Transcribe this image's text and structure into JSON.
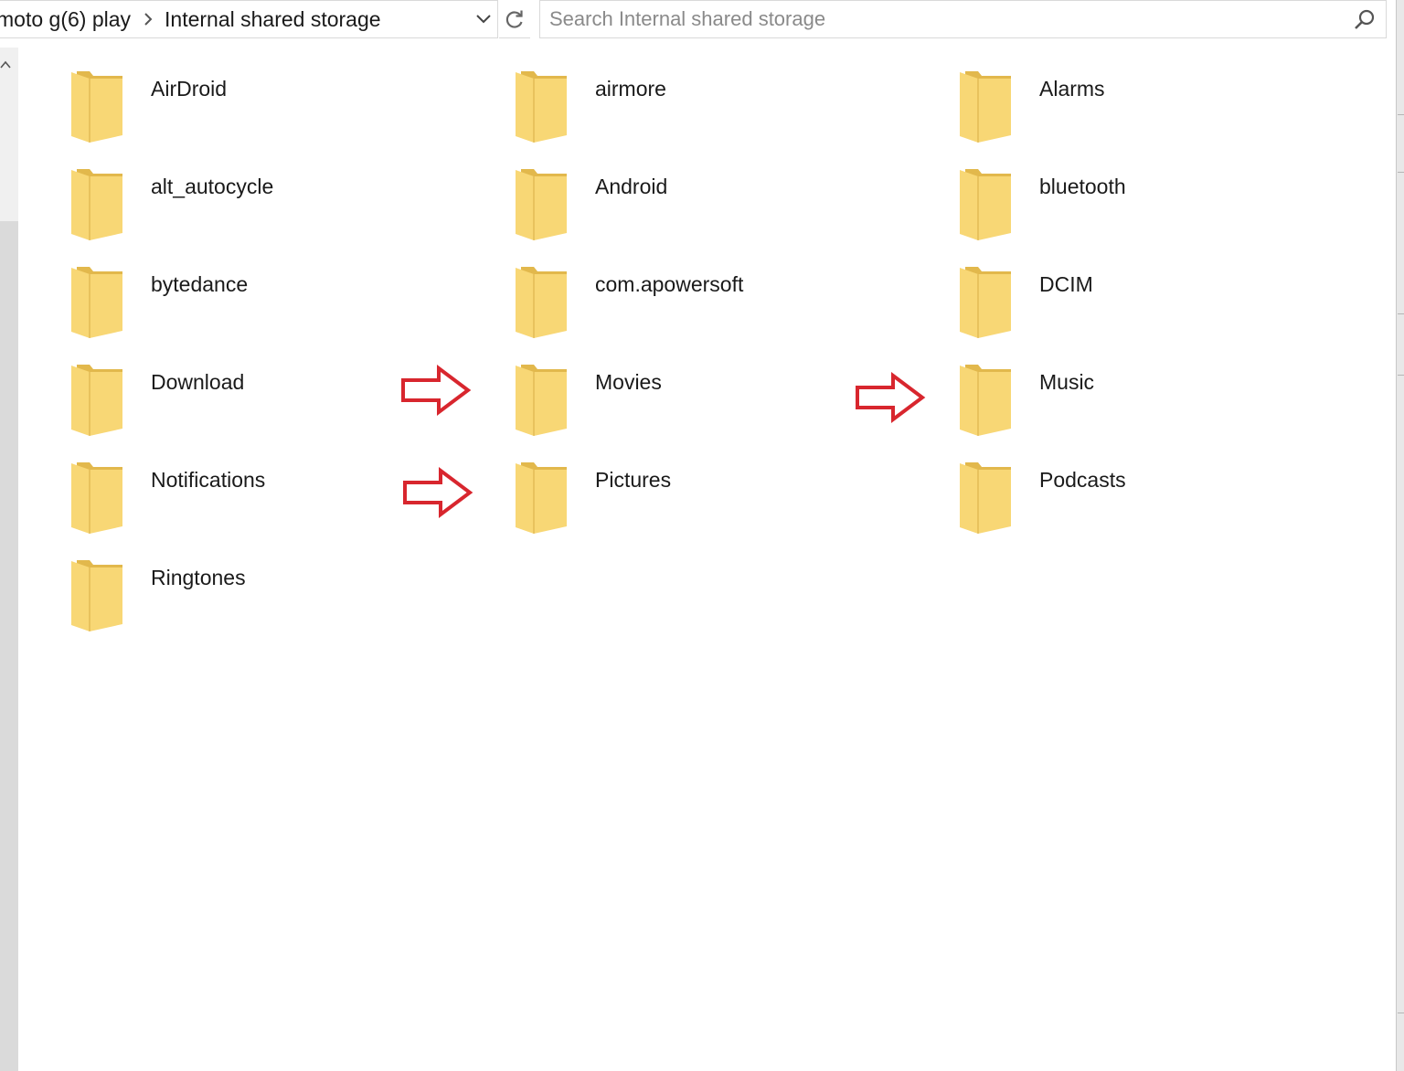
{
  "address_bar": {
    "crumbs": [
      "moto g(6) play",
      "Internal shared storage"
    ]
  },
  "search": {
    "placeholder": "Search Internal shared storage",
    "value": ""
  },
  "folders": [
    {
      "name": "AirDroid"
    },
    {
      "name": "airmore"
    },
    {
      "name": "Alarms"
    },
    {
      "name": "alt_autocycle"
    },
    {
      "name": "Android"
    },
    {
      "name": "bluetooth"
    },
    {
      "name": "bytedance"
    },
    {
      "name": "com.apowersoft"
    },
    {
      "name": "DCIM"
    },
    {
      "name": "Download"
    },
    {
      "name": "Movies"
    },
    {
      "name": "Music"
    },
    {
      "name": "Notifications"
    },
    {
      "name": "Pictures"
    },
    {
      "name": "Podcasts"
    },
    {
      "name": "Ringtones"
    }
  ],
  "annotations": {
    "arrows_point_to": [
      "Movies",
      "Music",
      "Pictures"
    ],
    "arrow_color": "#d8262e"
  },
  "colors": {
    "folder_front": "#f8d775",
    "folder_back": "#e2b84c",
    "border": "#d9d9d9"
  },
  "icons": {
    "breadcrumb_separator": "chevron-right-icon",
    "address_dropdown": "chevron-down-icon",
    "refresh": "refresh-icon",
    "search": "search-icon",
    "folder": "folder-icon",
    "scroll_up": "chevron-up-icon",
    "annotation": "arrow-right-icon"
  }
}
